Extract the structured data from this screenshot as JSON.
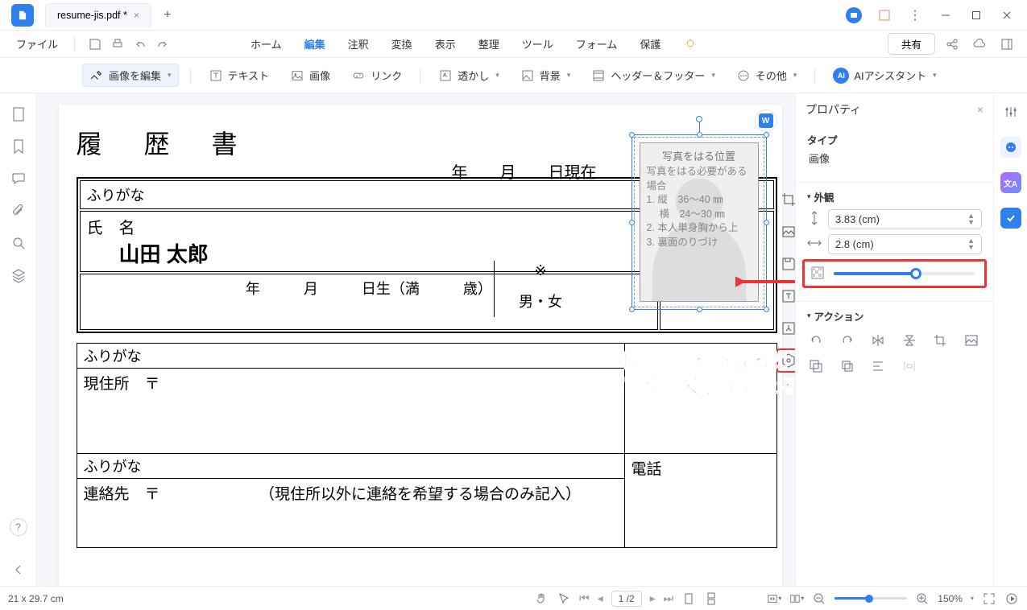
{
  "titlebar": {
    "tab_title": "resume-jis.pdf *",
    "close_glyph": "×",
    "plus_glyph": "+"
  },
  "menubar": {
    "file": "ファイル",
    "items": [
      "ホーム",
      "編集",
      "注釈",
      "変換",
      "表示",
      "整理",
      "ツール",
      "フォーム",
      "保護"
    ],
    "active_index": 1,
    "share": "共有"
  },
  "toolbar": {
    "edit_image": "画像を編集",
    "text": "テキスト",
    "image": "画像",
    "link": "リンク",
    "watermark": "透かし",
    "background": "背景",
    "header_footer": "ヘッダー＆フッター",
    "other": "その他",
    "ai_assist": "AIアシスタント",
    "ai_badge": "AI"
  },
  "document": {
    "title": "履 歴 書",
    "date_line": "年　　月　　日現在",
    "furigana": "ふりがな",
    "name_label": "氏　名",
    "name_value": "山田 太郎",
    "birthday_line": "年　　　月　　　日生（満　　　歳）",
    "gender_mark": "※",
    "gender_line": "男・女",
    "addr_label": "現住所　〒",
    "tel_label": "電話",
    "contact_label": "連絡先　〒",
    "contact_note": "（現住所以外に連絡を希望する場合のみ記入）",
    "photo": {
      "caption": "写真をはる位置",
      "l1": "写真をはる必要がある場合",
      "l2": "1. 縦　36～40 ㎜",
      "l3": "　 横　24～30 ㎜",
      "l4": "2. 本人単身胸から上",
      "l5": "3. 裏面のりづけ"
    }
  },
  "annotation": {
    "line1": "不透明度を下げると",
    "line2": "写真が薄く表示される"
  },
  "properties": {
    "panel_title": "プロパティ",
    "type_label": "タイプ",
    "type_value": "画像",
    "appearance_label": "外観",
    "height": "3.83 (cm)",
    "width": "2.8 (cm)",
    "action_label": "アクション"
  },
  "statusbar": {
    "page_size": "21 x 29.7 cm",
    "page_indicator": "1 /2",
    "zoom_label": "150%"
  },
  "glyphs": {
    "chevron": "▾",
    "tri_left": "◂",
    "tri_right": "▸",
    "spin": "▲\n▼",
    "minus": "−",
    "plus": "+",
    "more": "⋮"
  }
}
